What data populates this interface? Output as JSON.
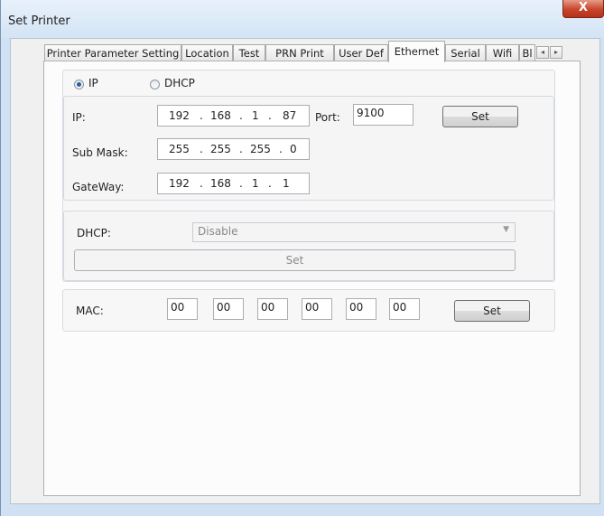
{
  "window": {
    "title": "Set Printer",
    "close_label": "X"
  },
  "tabs": [
    {
      "label": "Printer Parameter Setting"
    },
    {
      "label": "Location"
    },
    {
      "label": "Test"
    },
    {
      "label": "PRN Print"
    },
    {
      "label": "User Def"
    },
    {
      "label": "Ethernet",
      "active": true
    },
    {
      "label": "Serial"
    },
    {
      "label": "Wifi"
    },
    {
      "label": "Bl"
    }
  ],
  "tab_scroll": {
    "left": "◂",
    "right": "▸"
  },
  "mode": {
    "ip_label": "IP",
    "dhcp_label": "DHCP",
    "selected": "IP"
  },
  "ip_settings": {
    "ip_label": "IP:",
    "ip": [
      "192",
      "168",
      "1",
      "87"
    ],
    "port_label": "Port:",
    "port": "9100",
    "set_label": "Set",
    "mask_label": "Sub Mask:",
    "mask": [
      "255",
      "255",
      "255",
      "0"
    ],
    "gateway_label": "GateWay:",
    "gateway": [
      "192",
      "168",
      "1",
      "1"
    ]
  },
  "dhcp_settings": {
    "label": "DHCP:",
    "value": "Disable",
    "set_label": "Set"
  },
  "mac_settings": {
    "label": "MAC:",
    "octets": [
      "00",
      "00",
      "00",
      "00",
      "00",
      "00"
    ],
    "set_label": "Set"
  },
  "colors": {
    "window_frame": "#cfe1f2",
    "close_button": "#c7452b",
    "radio_dot": "#2b5f9e"
  }
}
